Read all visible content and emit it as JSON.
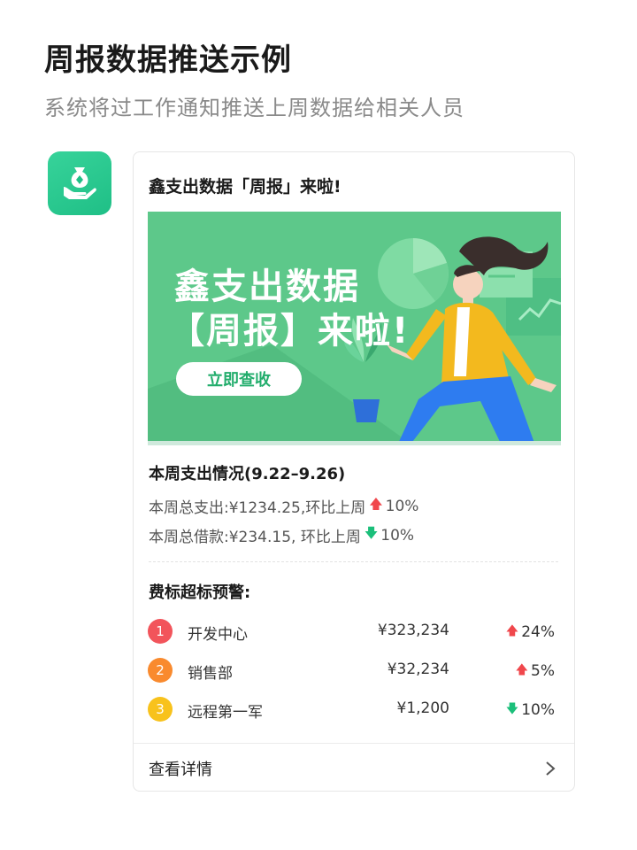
{
  "page": {
    "title": "周报数据推送示例",
    "subtitle": "系统将过工作通知推送上周数据给相关人员"
  },
  "app_icon": {
    "name": "money-bag-hand-icon"
  },
  "card": {
    "title": "鑫支出数据「周报」来啦!",
    "banner": {
      "line1": "鑫支出数据",
      "line2": "【周报】来啦!",
      "button_label": "立即查收"
    },
    "week": {
      "title": "本周支出情况(9.22–9.26)",
      "total_spend_prefix": "本周总支出:¥1234.25,环比上周",
      "total_spend_change": "10%",
      "total_spend_direction": "up",
      "total_borrow_prefix": "本周总借款:¥234.15, 环比上周",
      "total_borrow_change": "10%",
      "total_borrow_direction": "down"
    },
    "warning": {
      "title": "费标超标预警:",
      "rows": [
        {
          "rank": "1",
          "rank_color": "#f2545b",
          "name": "开发中心",
          "amount": "¥323,234",
          "change": "24%",
          "direction": "up"
        },
        {
          "rank": "2",
          "rank_color": "#f98a2e",
          "name": "销售部",
          "amount": "¥32,234",
          "change": "5%",
          "direction": "up"
        },
        {
          "rank": "3",
          "rank_color": "#f8c21c",
          "name": "远程第一军",
          "amount": "¥1,200",
          "change": "10%",
          "direction": "down"
        }
      ]
    },
    "footer": {
      "label": "查看详情",
      "icon": "chevron-right-icon"
    }
  },
  "colors": {
    "brand_green": "#1fbf86",
    "up_red": "#f0474c",
    "down_green": "#1bbf7a",
    "banner_bg": "#5dc88a"
  }
}
